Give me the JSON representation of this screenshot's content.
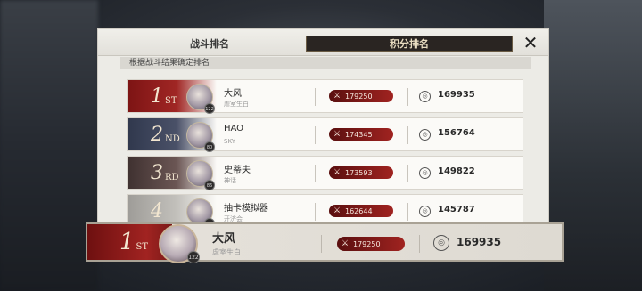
{
  "tabs": {
    "battle_rank": "战斗排名",
    "score_rank": "积分排名"
  },
  "close_icon": "close-icon",
  "subtitle": "根据战斗结果确定排名",
  "rows": [
    {
      "rank": "1",
      "suffix": "ST",
      "name": "大风",
      "title": "虐室生白",
      "level": "122",
      "battle": "179250",
      "points": "169935"
    },
    {
      "rank": "2",
      "suffix": "ND",
      "name": "HAO",
      "title": "SKY",
      "level": "80",
      "battle": "174345",
      "points": "156764"
    },
    {
      "rank": "3",
      "suffix": "RD",
      "name": "史蒂夫",
      "title": "神话",
      "level": "86",
      "battle": "173593",
      "points": "149822"
    },
    {
      "rank": "4",
      "suffix": "",
      "name": "抽卡模拟器",
      "title": "开济会",
      "level": "114",
      "battle": "162644",
      "points": "145787"
    }
  ],
  "me": {
    "rank": "1",
    "suffix": "ST",
    "name": "大风",
    "title": "虐室生白",
    "level": "122",
    "battle": "179250",
    "points": "169935"
  },
  "colors": {
    "rank1": "#a02624",
    "rank2": "#4a5168",
    "rank3": "#6b5654",
    "rank4": "#c2c0bb",
    "battle_pill": "#a02320"
  },
  "icons": {
    "battle": "crossed-swords-icon",
    "points": "target-icon"
  }
}
